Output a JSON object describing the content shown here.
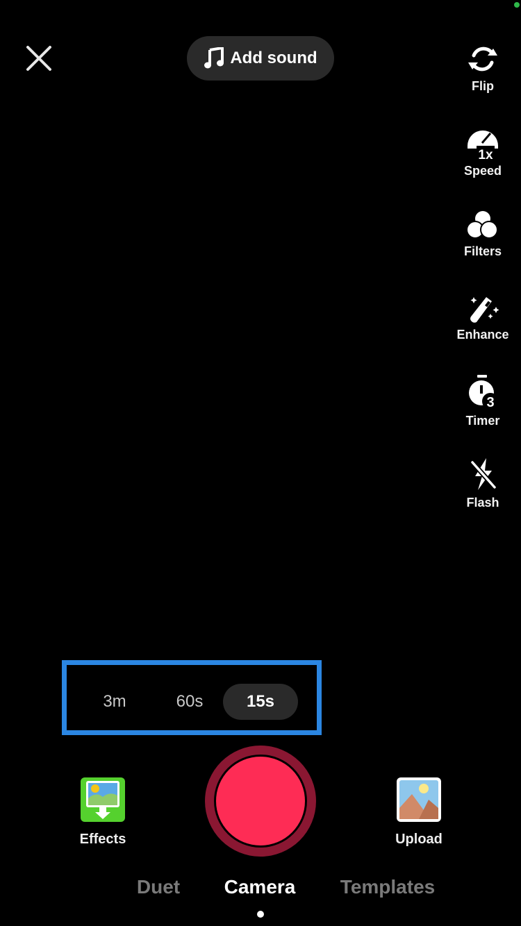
{
  "top_bar": {
    "close_icon": "close-icon",
    "add_sound": {
      "icon": "music-note-icon",
      "label": "Add sound"
    }
  },
  "side_rail": [
    {
      "id": "flip",
      "icon": "flip-camera-icon",
      "label": "Flip"
    },
    {
      "id": "speed",
      "icon": "speed-gauge-icon",
      "label": "Speed",
      "badge": "1x"
    },
    {
      "id": "filters",
      "icon": "filters-icon",
      "label": "Filters"
    },
    {
      "id": "enhance",
      "icon": "magic-wand-icon",
      "label": "Enhance"
    },
    {
      "id": "timer",
      "icon": "timer-icon",
      "label": "Timer",
      "badge": "3"
    },
    {
      "id": "flash",
      "icon": "flash-off-icon",
      "label": "Flash"
    }
  ],
  "duration": {
    "options": [
      "3m",
      "60s",
      "15s"
    ],
    "selected": "15s",
    "highlight_color": "#2b86e2"
  },
  "bottom": {
    "effects": {
      "icon": "effects-image-icon",
      "label": "Effects"
    },
    "upload": {
      "icon": "upload-image-icon",
      "label": "Upload"
    },
    "record": {
      "color": "#fe2c55",
      "ring_color": "#8a1732"
    }
  },
  "modes": {
    "items": [
      "Duet",
      "Camera",
      "Templates"
    ],
    "active": "Camera"
  },
  "status": {
    "indicator_color": "#2fb84a"
  }
}
